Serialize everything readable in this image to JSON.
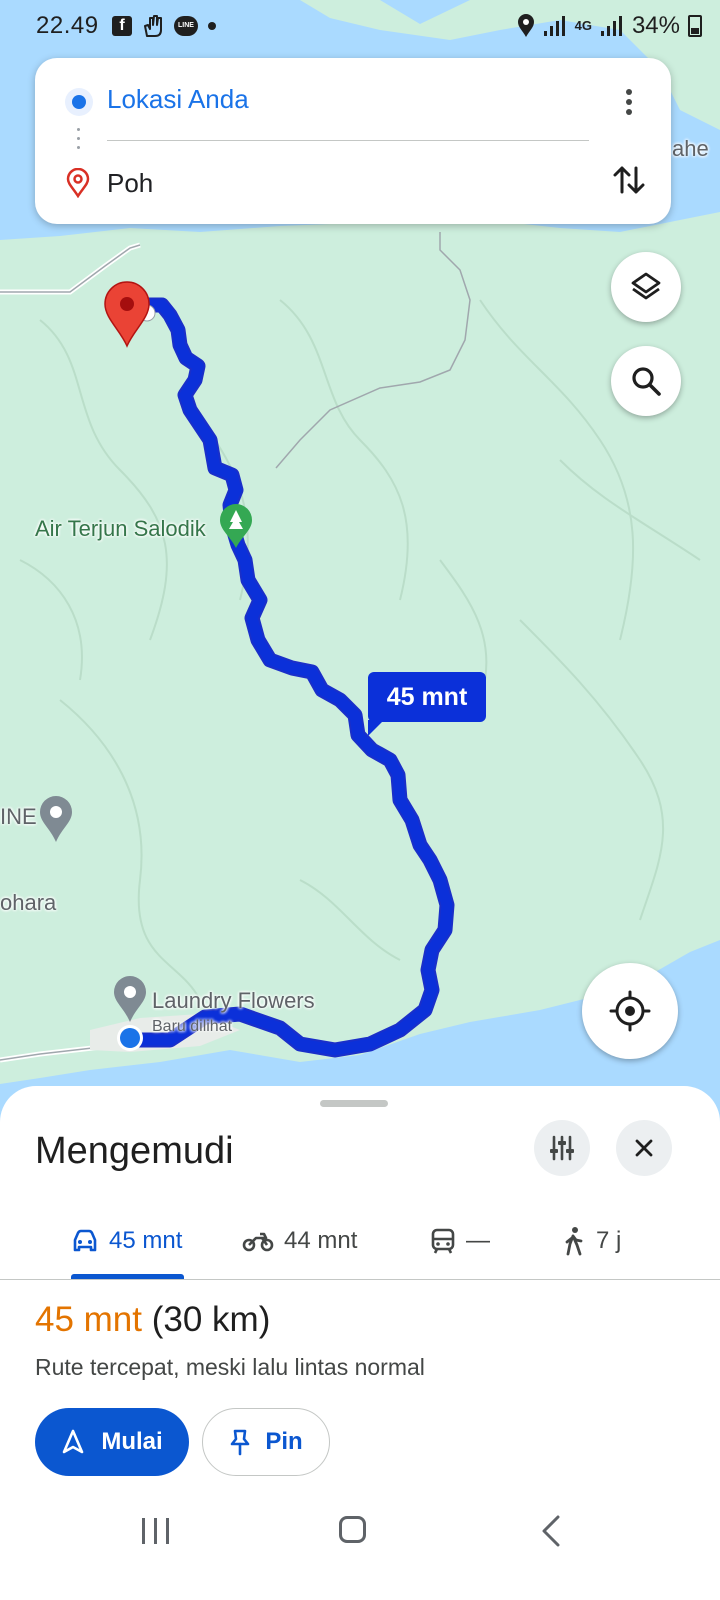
{
  "status_bar": {
    "time": "22.49",
    "battery": "34%",
    "network": "4G",
    "icons": [
      "facebook-icon",
      "hand-icon",
      "line-icon",
      "dot-icon",
      "location-icon",
      "signal-icon",
      "battery-icon"
    ]
  },
  "route": {
    "origin": "Lokasi Anda",
    "destination": "Poh"
  },
  "map": {
    "labels": {
      "waterfall": "Air Terjun Salodik",
      "partial_left_1": "INE",
      "partial_left_2": "ohara",
      "partial_right": "ahe",
      "laundry": "Laundry Flowers",
      "laundry_sub": "Baru dilihat"
    },
    "eta_bubble": "45 mnt",
    "colors": {
      "land": "#cdeedd",
      "water": "#aadaff",
      "route": "#0b30d9",
      "route_outline": "#1a2fc9"
    }
  },
  "sheet": {
    "title": "Mengemudi",
    "tabs": [
      {
        "label": "45 mnt",
        "icon": "car-icon",
        "active": true
      },
      {
        "label": "44 mnt",
        "icon": "motorcycle-icon",
        "active": false
      },
      {
        "label": "—",
        "icon": "transit-icon",
        "active": false
      },
      {
        "label": "7 j",
        "icon": "walk-icon",
        "active": false
      }
    ],
    "summary_duration": "45 mnt",
    "summary_distance": "(30 km)",
    "summary_note": "Rute tercepat, meski lalu lintas normal",
    "start_label": "Mulai",
    "pin_label": "Pin"
  }
}
